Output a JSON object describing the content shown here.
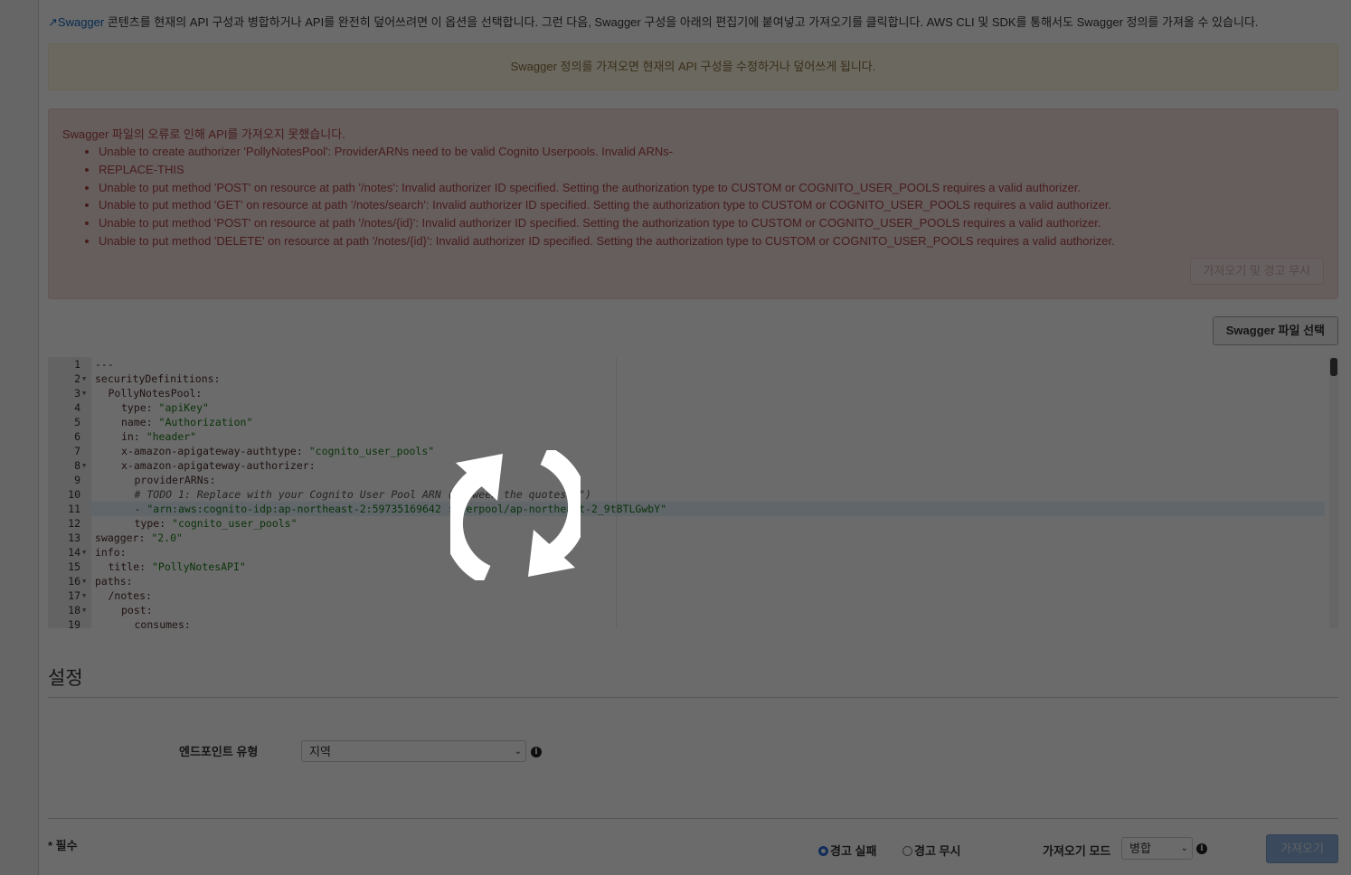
{
  "intro": {
    "link": "Swagger",
    "text": " 콘텐츠를 현재의 API 구성과 병합하거나 API를 완전히 덮어쓰려면 이 옵션을 선택합니다. 그런 다음, Swagger 구성을 아래의 편집기에 붙여넣고 가져오기를 클릭합니다. AWS CLI 및 SDK를 통해서도 Swagger 정의를 가져올 수 있습니다."
  },
  "warning": "Swagger 정의를 가져오면 현재의 API 구성을 수정하거나 덮어쓰게 됩니다.",
  "error": {
    "title": "Swagger 파일의 오류로 인해 API를 가져오지 못했습니다.",
    "items": [
      "Unable to create authorizer 'PollyNotesPool': ProviderARNs need to be valid Cognito Userpools. Invalid ARNs-",
      "REPLACE-THIS",
      "Unable to put method 'POST' on resource at path '/notes': Invalid authorizer ID specified. Setting the authorization type to CUSTOM or COGNITO_USER_POOLS requires a valid authorizer.",
      "Unable to put method 'GET' on resource at path '/notes/search': Invalid authorizer ID specified. Setting the authorization type to CUSTOM or COGNITO_USER_POOLS requires a valid authorizer.",
      "Unable to put method 'POST' on resource at path '/notes/{id}': Invalid authorizer ID specified. Setting the authorization type to CUSTOM or COGNITO_USER_POOLS requires a valid authorizer.",
      "Unable to put method 'DELETE' on resource at path '/notes/{id}': Invalid authorizer ID specified. Setting the authorization type to CUSTOM or COGNITO_USER_POOLS requires a valid authorizer."
    ],
    "ignore_button": "가져오기 및 경고 무시"
  },
  "swagger_file_button": "Swagger 파일 선택",
  "editor": {
    "lines": [
      {
        "n": "1",
        "fold": false,
        "indent": 0,
        "key": "---",
        "val": ""
      },
      {
        "n": "2",
        "fold": true,
        "indent": 0,
        "key": "securityDefinitions:",
        "val": ""
      },
      {
        "n": "3",
        "fold": true,
        "indent": 1,
        "key": "PollyNotesPool:",
        "val": ""
      },
      {
        "n": "4",
        "fold": false,
        "indent": 2,
        "key": "type: ",
        "val": "\"apiKey\""
      },
      {
        "n": "5",
        "fold": false,
        "indent": 2,
        "key": "name: ",
        "val": "\"Authorization\""
      },
      {
        "n": "6",
        "fold": false,
        "indent": 2,
        "key": "in: ",
        "val": "\"header\""
      },
      {
        "n": "7",
        "fold": false,
        "indent": 2,
        "key": "x-amazon-apigateway-authtype: ",
        "val": "\"cognito_user_pools\""
      },
      {
        "n": "8",
        "fold": true,
        "indent": 2,
        "key": "x-amazon-apigateway-authorizer:",
        "val": ""
      },
      {
        "n": "9",
        "fold": false,
        "indent": 3,
        "key": "providerARNs:",
        "val": ""
      },
      {
        "n": "10",
        "fold": false,
        "indent": 3,
        "comment": "# TODO 1: Replace with your Cognito User Pool ARN (between the quotes \"\")"
      },
      {
        "n": "11",
        "fold": false,
        "indent": 3,
        "key": "- ",
        "val": "\"arn:aws:cognito-idp:ap-northeast-2:59735169642 :userpool/ap-northeast-2_9tBTLGwbY\""
      },
      {
        "n": "12",
        "fold": false,
        "indent": 3,
        "key": "type: ",
        "val": "\"cognito_user_pools\""
      },
      {
        "n": "13",
        "fold": false,
        "indent": 0,
        "key": "swagger: ",
        "val": "\"2.0\""
      },
      {
        "n": "14",
        "fold": true,
        "indent": 0,
        "key": "info:",
        "val": ""
      },
      {
        "n": "15",
        "fold": false,
        "indent": 1,
        "key": "title: ",
        "val": "\"PollyNotesAPI\""
      },
      {
        "n": "16",
        "fold": true,
        "indent": 0,
        "key": "paths:",
        "val": ""
      },
      {
        "n": "17",
        "fold": true,
        "indent": 1,
        "key": "/notes:",
        "val": ""
      },
      {
        "n": "18",
        "fold": true,
        "indent": 2,
        "key": "post:",
        "val": ""
      },
      {
        "n": "19",
        "fold": false,
        "indent": 3,
        "key": "consumes:",
        "val": ""
      }
    ]
  },
  "settings": {
    "title": "설정",
    "endpoint_label": "엔드포인트 유형",
    "endpoint_value": "지역"
  },
  "footer": {
    "required": "* 필수",
    "radio_fail": "경고 실패",
    "radio_ignore": "경고 무시",
    "radio_selected": "fail",
    "mode_label": "가져오기 모드",
    "mode_value": "병합",
    "import_button": "가져오기"
  },
  "overlay": {
    "icon": "refresh-spinner-icon"
  }
}
